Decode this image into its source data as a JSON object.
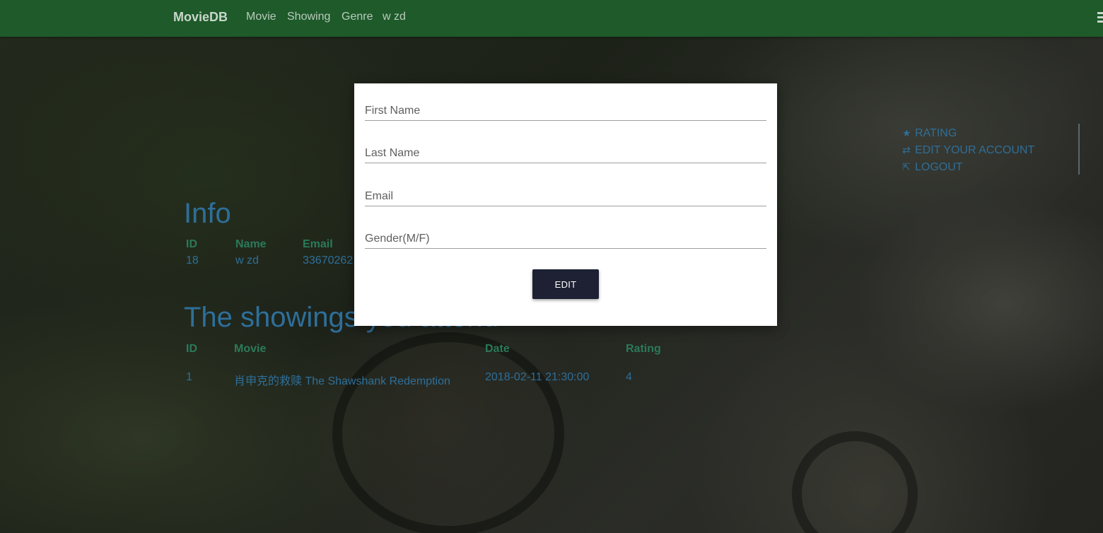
{
  "navbar": {
    "brand": "MovieDB",
    "links": [
      "Movie",
      "Showing",
      "Genre",
      "w zd"
    ]
  },
  "side_menu": {
    "items": [
      {
        "icon": "star-icon",
        "glyph": "★",
        "label": "RATING"
      },
      {
        "icon": "swap-icon",
        "glyph": "⇄",
        "label": "EDIT YOUR ACCOUNT"
      },
      {
        "icon": "external-link-icon",
        "glyph": "⇱",
        "label": "LOGOUT"
      }
    ]
  },
  "info": {
    "heading": "Info",
    "headers": [
      "ID",
      "Name",
      "Email"
    ],
    "row": [
      "18",
      "w zd",
      "33670262"
    ]
  },
  "showings": {
    "heading": "The showings you attend",
    "headers": [
      "ID",
      "Movie",
      "Date",
      "Rating"
    ],
    "rows": [
      [
        "1",
        "肖申克的救赎 The Shawshank Redemption",
        "2018-02-11 21:30:00",
        "4"
      ]
    ]
  },
  "modal": {
    "fields": [
      {
        "placeholder": "First Name",
        "value": ""
      },
      {
        "placeholder": "Last Name",
        "value": ""
      },
      {
        "placeholder": "Email",
        "value": ""
      },
      {
        "placeholder": "Gender(M/F)",
        "value": ""
      }
    ],
    "submit_label": "EDIT"
  },
  "colors": {
    "navbar": "#1e5a2a",
    "link_blue": "#2e6f9a",
    "header_green": "#2b7a59",
    "button_dark": "#1d2133"
  }
}
